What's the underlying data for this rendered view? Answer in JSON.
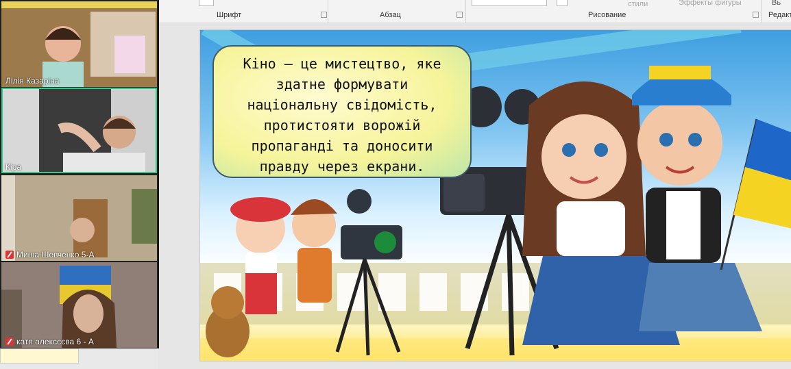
{
  "ribbon": {
    "groups": [
      {
        "label": "Шрифт"
      },
      {
        "label": "Абзац"
      },
      {
        "label": "Рисование"
      },
      {
        "label": "Редакт"
      }
    ],
    "faint": {
      "styles": "стили",
      "effects": "Эффекты фигуры",
      "select": "Вь"
    }
  },
  "participants": [
    {
      "name": "Лілія Казаріна",
      "muted": false,
      "active": false
    },
    {
      "name": "Кіра",
      "muted": false,
      "active": true
    },
    {
      "name": "Миша Шевченко 5-А",
      "muted": true,
      "active": false
    },
    {
      "name": "катя алексєєва 6 - А",
      "muted": true,
      "active": false
    }
  ],
  "slide": {
    "quote": "Кіно — це мистецтво, яке\nздатне формувати\nнаціональну свідомість,\nпротистояти ворожій\nпропаганді та доносити\nправду через екрани."
  },
  "colors": {
    "active_tile_border": "#36c98a",
    "muted_icon": "#dd3333",
    "bubble_border": "#3c5a6a"
  }
}
